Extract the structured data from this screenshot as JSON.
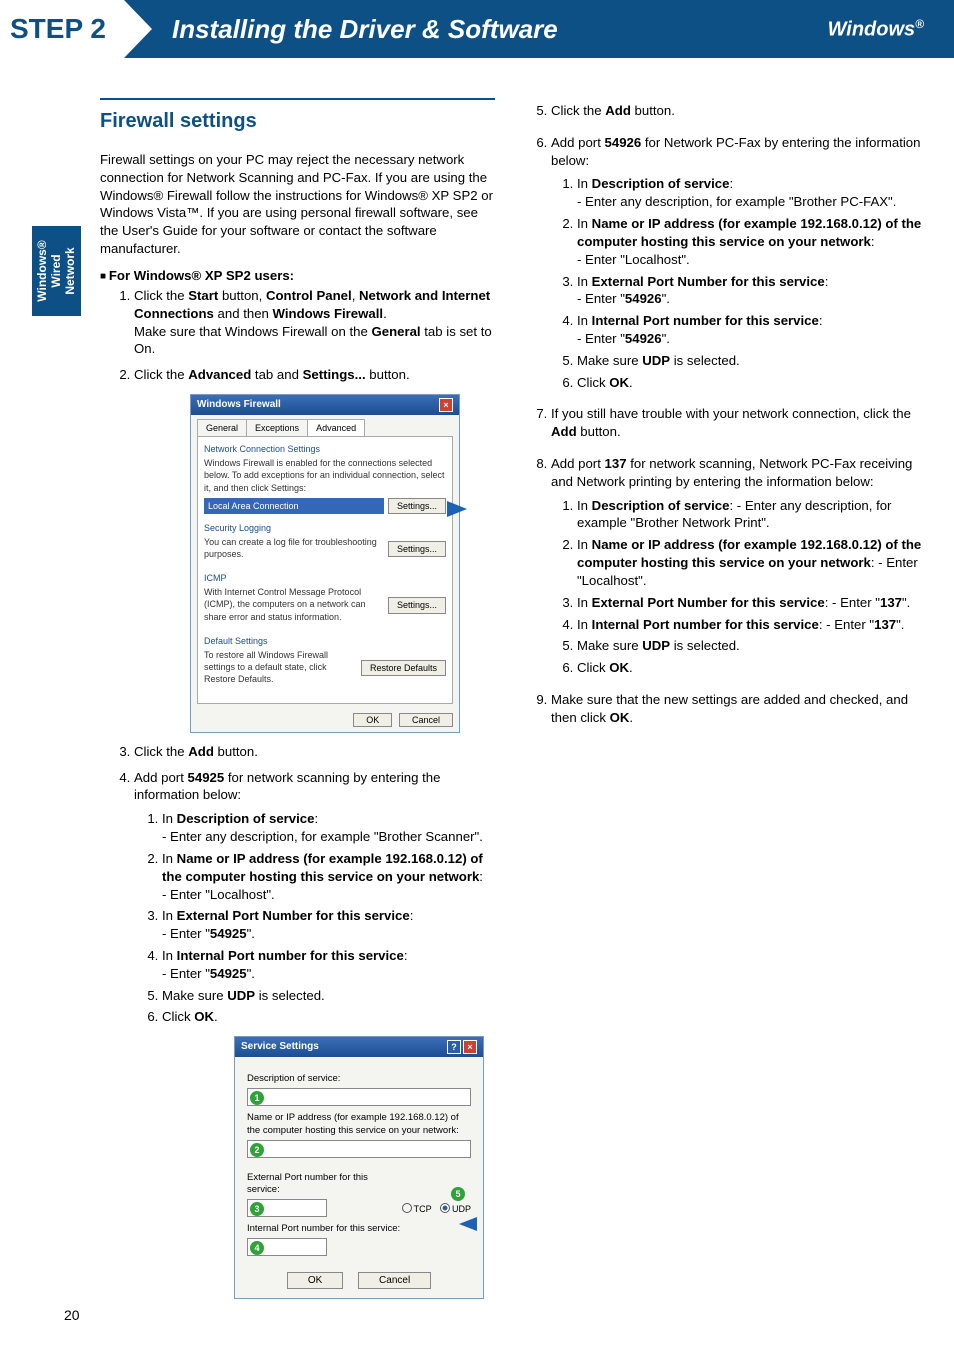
{
  "banner": {
    "step": "STEP 2",
    "title": "Installing the Driver & Software",
    "os": "Windows",
    "reg": "®"
  },
  "side_tab": {
    "l1": "Windows®",
    "l2": "Wired",
    "l3": "Network"
  },
  "left": {
    "section_title": "Firewall settings",
    "intro": "Firewall settings on your PC may reject the necessary network connection for Network Scanning and PC-Fax. If you are using the Windows® Firewall follow the instructions for Windows® XP SP2 or Windows Vista™. If you are using personal firewall software, see the User's Guide for your software or contact the software manufacturer.",
    "xp_heading": "For Windows® XP SP2 users:",
    "step1a": "Click the ",
    "step1_start": "Start",
    "step1b": " button, ",
    "step1_cp": "Control Panel",
    "step1c": ", ",
    "step1_nic": "Network and Internet Connections",
    "step1d": " and then ",
    "step1_wf": "Windows Firewall",
    "step1e": ".",
    "step1f": "Make sure that Windows Firewall on the ",
    "step1_gen": "General",
    "step1g": " tab is set to On.",
    "step2a": "Click the ",
    "step2_adv": "Advanced",
    "step2b": " tab and ",
    "step2_set": "Settings...",
    "step2c": " button.",
    "dlg1": {
      "title": "Windows Firewall",
      "tab1": "General",
      "tab2": "Exceptions",
      "tab3": "Advanced",
      "g1_title": "Network Connection Settings",
      "g1_text": "Windows Firewall is enabled for the connections selected below. To add exceptions for an individual connection, select it, and then click Settings:",
      "g1_lan": "Local Area Connection",
      "g1_btn": "Settings...",
      "g2_title": "Security Logging",
      "g2_text": "You can create a log file for troubleshooting purposes.",
      "g2_btn": "Settings...",
      "g3_title": "ICMP",
      "g3_text": "With Internet Control Message Protocol (ICMP), the computers on a network can share error and status information.",
      "g3_btn": "Settings...",
      "g4_title": "Default Settings",
      "g4_text": "To restore all Windows Firewall settings to a default state, click Restore Defaults.",
      "g4_btn": "Restore Defaults",
      "ok": "OK",
      "cancel": "Cancel"
    },
    "step3a": "Click the ",
    "step3_add": "Add",
    "step3b": " button.",
    "step4a": "Add port ",
    "step4_port": "54925",
    "step4b": " for network scanning by entering the information below:",
    "s4_1a": "In ",
    "s4_1b": "Description of service",
    "s4_1c": ":",
    "s4_1d": "- Enter any description, for example  \"Brother Scanner\".",
    "s4_2a": "In ",
    "s4_2b": "Name or IP address (for example 192.168.0.12) of the computer hosting this service on your network",
    "s4_2c": ":",
    "s4_2d": "- Enter \"Localhost\".",
    "s4_3a": "In ",
    "s4_3b": "External Port Number for this service",
    "s4_3c": ":",
    "s4_3d": "- Enter \"",
    "s4_3e": "54925",
    "s4_3f": "\".",
    "s4_4a": "In ",
    "s4_4b": "Internal Port number for this service",
    "s4_4c": ":",
    "s4_4d": "- Enter \"",
    "s4_4e": "54925",
    "s4_4f": "\".",
    "s4_5a": "Make sure ",
    "s4_5b": "UDP",
    "s4_5c": " is selected.",
    "s4_6a": "Click ",
    "s4_6b": "OK",
    "s4_6c": ".",
    "dlg2": {
      "title": "Service Settings",
      "l1": "Description of service:",
      "l2": "Name or IP address (for example 192.168.0.12) of the computer hosting this service on your network:",
      "l3": "External Port number for this service:",
      "l4": "Internal Port number for this service:",
      "tcp": "TCP",
      "udp": "UDP",
      "ok": "OK",
      "cancel": "Cancel",
      "c1": "1",
      "c2": "2",
      "c3": "3",
      "c4": "4",
      "c5": "5"
    }
  },
  "right": {
    "step5a": "Click the ",
    "step5_add": "Add",
    "step5b": " button.",
    "step6a": "Add port ",
    "step6_port": "54926",
    "step6b": " for Network PC-Fax by entering the information below:",
    "s6_1a": "In ",
    "s6_1b": "Description of service",
    "s6_1c": ":",
    "s6_1d": "- Enter any description, for example  \"Brother PC-FAX\".",
    "s6_2a": "In ",
    "s6_2b": "Name or IP address (for example 192.168.0.12) of the computer hosting this service on your network",
    "s6_2c": ":",
    "s6_2d": "- Enter \"Localhost\".",
    "s6_3a": "In ",
    "s6_3b": "External Port Number for this service",
    "s6_3c": ":",
    "s6_3d": "- Enter \"",
    "s6_3e": "54926",
    "s6_3f": "\".",
    "s6_4a": "In ",
    "s6_4b": "Internal Port number for this service",
    "s6_4c": ":",
    "s6_4d": "- Enter \"",
    "s6_4e": "54926",
    "s6_4f": "\".",
    "s6_5a": "Make sure ",
    "s6_5b": "UDP",
    "s6_5c": " is selected.",
    "s6_6a": "Click ",
    "s6_6b": "OK",
    "s6_6c": ".",
    "step7a": "If you still have trouble with your network connection, click the ",
    "step7_add": "Add",
    "step7b": " button.",
    "step8a": "Add port ",
    "step8_port": "137",
    "step8b": " for network scanning, Network PC-Fax receiving and Network printing by entering the information below:",
    "s8_1a": "In ",
    "s8_1b": "Description of service",
    "s8_1c": ": - Enter any description, for example \"Brother Network Print\".",
    "s8_2a": "In ",
    "s8_2b": "Name or IP address (for example 192.168.0.12) of the computer hosting this service on your network",
    "s8_2c": ": - Enter \"Localhost\".",
    "s8_3a": "In ",
    "s8_3b": "External Port Number for this service",
    "s8_3c": ": - Enter \"",
    "s8_3d": "137",
    "s8_3e": "\".",
    "s8_4a": "In ",
    "s8_4b": "Internal Port number for this service",
    "s8_4c": ": - Enter \"",
    "s8_4d": "137",
    "s8_4e": "\".",
    "s8_5a": "Make sure ",
    "s8_5b": "UDP",
    "s8_5c": " is selected.",
    "s8_6a": "Click ",
    "s8_6b": "OK",
    "s8_6c": ".",
    "step9a": "Make sure that the new settings are added and checked, and then click ",
    "step9_ok": "OK",
    "step9b": "."
  },
  "page_number": "20"
}
